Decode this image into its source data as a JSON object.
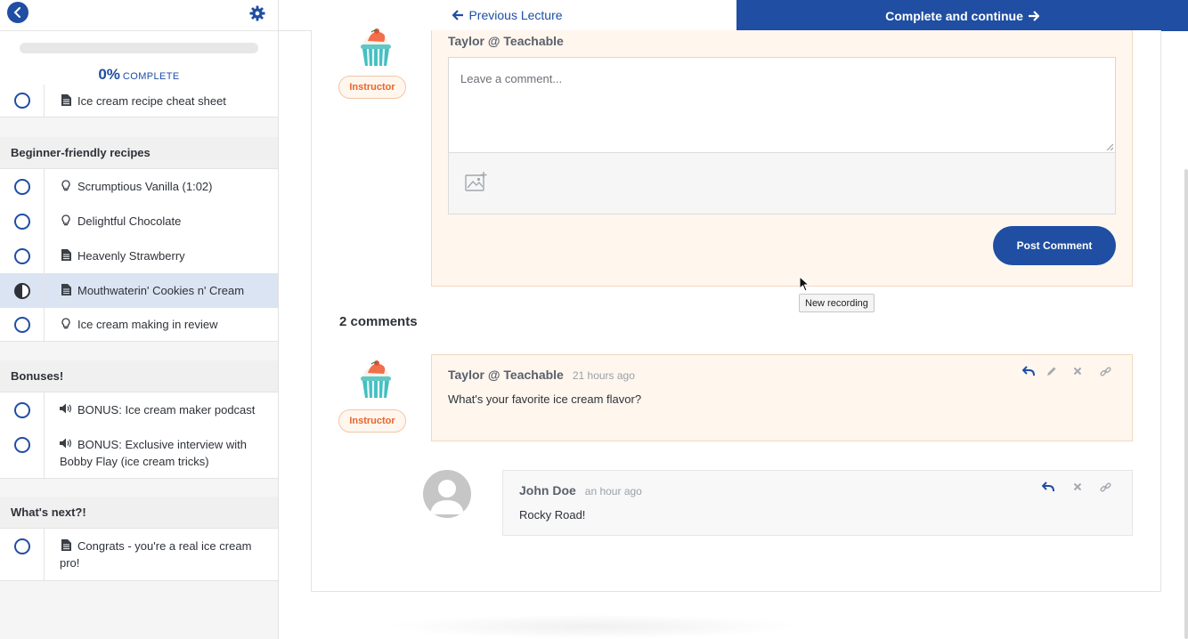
{
  "sidebar": {
    "progress": {
      "percent": "0%",
      "label": "COMPLETE"
    },
    "top_lecture": {
      "title": "Ice cream recipe cheat sheet",
      "icon": "document-icon"
    },
    "sections": [
      {
        "title": "Beginner-friendly recipes",
        "lectures": [
          {
            "title": "Scrumptious Vanilla (1:02)",
            "icon": "lightbulb-icon",
            "status": "incomplete"
          },
          {
            "title": "Delightful Chocolate",
            "icon": "lightbulb-icon",
            "status": "incomplete"
          },
          {
            "title": "Heavenly Strawberry",
            "icon": "document-icon",
            "status": "incomplete"
          },
          {
            "title": "Mouthwaterin' Cookies n' Cream",
            "icon": "document-icon",
            "status": "in-progress"
          },
          {
            "title": "Ice cream making in review",
            "icon": "lightbulb-icon",
            "status": "incomplete"
          }
        ]
      },
      {
        "title": "Bonuses!",
        "lectures": [
          {
            "title": "BONUS: Ice cream maker podcast",
            "icon": "audio-icon",
            "status": "incomplete"
          },
          {
            "title_line1": "BONUS: Exclusive interview with",
            "title_line2": "Bobby Flay (ice cream tricks)",
            "icon": "audio-icon",
            "status": "incomplete"
          }
        ]
      },
      {
        "title": "What's next?!",
        "lectures": [
          {
            "title_line1": "Congrats - you're a real ice cream",
            "title_line2": "pro!",
            "icon": "document-icon",
            "status": "incomplete"
          }
        ]
      }
    ]
  },
  "nav": {
    "prev_label": "Previous Lecture",
    "next_label": "Complete and continue"
  },
  "comment_form": {
    "author": "Taylor @ Teachable",
    "badge": "Instructor",
    "placeholder": "Leave a comment...",
    "post_label": "Post Comment"
  },
  "tooltip": "New recording",
  "comments": {
    "count_label": "2 comments",
    "items": [
      {
        "author": "Taylor @ Teachable",
        "time": "21 hours ago",
        "badge": "Instructor",
        "text": "What's your favorite ice cream flavor?"
      },
      {
        "author": "John Doe",
        "time": "an hour ago",
        "text": "Rocky Road!"
      }
    ]
  },
  "colors": {
    "primary": "#1f4ea3",
    "instructor_bg": "#fff6ee",
    "instructor_text": "#e5662e"
  }
}
